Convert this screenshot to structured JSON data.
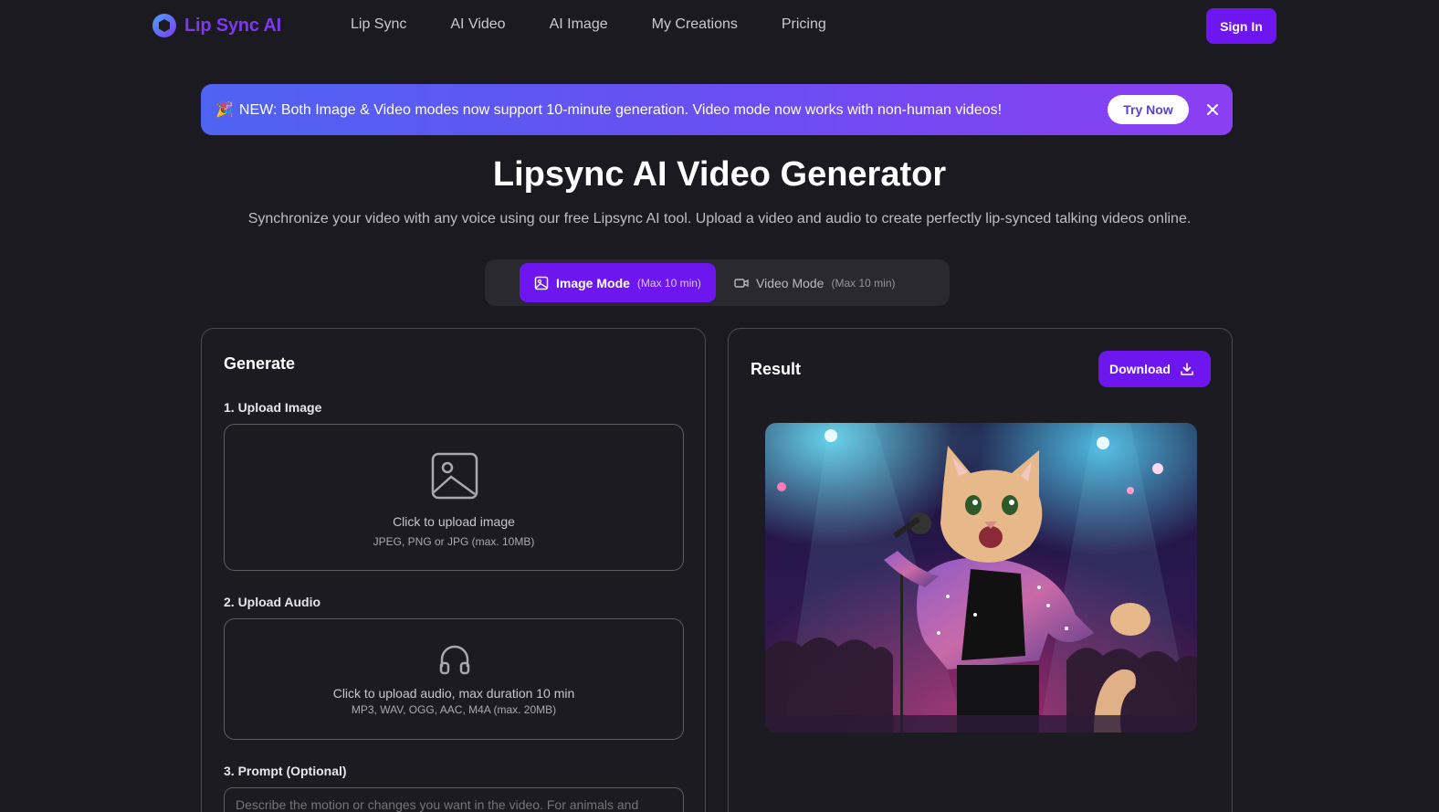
{
  "brand": {
    "name": "Lip Sync AI",
    "accent": "#7c3aed",
    "logo_icon": "hexagon-ring-icon"
  },
  "nav": {
    "links": [
      "Lip Sync",
      "AI Video",
      "AI Image",
      "My Creations",
      "Pricing"
    ],
    "signin_label": "Sign In"
  },
  "banner": {
    "emoji": "🎉",
    "text": "NEW: Both Image & Video modes now support 10-minute generation. Video mode now works with non-human videos!",
    "cta_label": "Try Now",
    "close_icon": "close-icon"
  },
  "hero": {
    "title": "Lipsync AI Video Generator",
    "subtitle": "Synchronize your video with any voice using our free Lipsync AI tool. Upload a video and audio to create perfectly lip-synced talking videos online."
  },
  "modes": {
    "image": {
      "label": "Image Mode",
      "limit": "(Max 10 min)",
      "icon": "image-icon",
      "active": true
    },
    "video": {
      "label": "Video Mode",
      "limit": "(Max 10 min)",
      "icon": "video-camera-icon",
      "active": false
    }
  },
  "generate": {
    "title": "Generate",
    "upload_image": {
      "label": "1. Upload Image",
      "main": "Click to upload image",
      "sub": "JPEG, PNG or JPG (max. 10MB)",
      "icon": "image-icon"
    },
    "upload_audio": {
      "label": "2. Upload Audio",
      "main": "Click to upload audio, max duration 10 min",
      "sub": "MP3, WAV, OGG, AAC, M4A (max. 20MB)",
      "icon": "headphones-icon"
    },
    "prompt": {
      "label": "3. Prompt (Optional)",
      "placeholder": "Describe the motion or changes you want in the video. For animals and"
    }
  },
  "result": {
    "title": "Result",
    "download_label": "Download",
    "download_icon": "download-icon",
    "image_alt": "Cat in sequined jacket singing into microphone on concert stage"
  },
  "colors": {
    "background": "#1b1a20",
    "primary": "#6d16f0",
    "banner_start": "#4f63f2",
    "banner_end": "#8b3ff2"
  }
}
